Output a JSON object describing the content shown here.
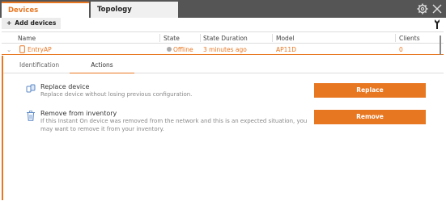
{
  "tabs": [
    {
      "label": "Devices",
      "active": true
    },
    {
      "label": "Topology",
      "active": false
    }
  ],
  "toolbar": {
    "add_label": "Add devices"
  },
  "table": {
    "headers": {
      "name": "Name",
      "state": "State",
      "state_duration": "State Duration",
      "model": "Model",
      "clients": "Clients"
    },
    "row": {
      "name": "EntryAP",
      "state": "Offline",
      "state_duration": "3 minutes ago",
      "model": "AP11D",
      "clients": "0"
    }
  },
  "detail_tabs": [
    {
      "label": "Identification",
      "active": false
    },
    {
      "label": "Actions",
      "active": true
    }
  ],
  "actions": {
    "replace": {
      "title": "Replace device",
      "desc": "Replace device without losing previous configuration.",
      "button": "Replace"
    },
    "remove": {
      "title": "Remove from inventory",
      "desc1": "If this Instant On device was removed from the network and this is an expected situation, you",
      "desc2": "may want to remove it from your inventory.",
      "button": "Remove"
    }
  },
  "colors": {
    "accent": "#e87722",
    "tabbar": "#555555",
    "offline": "#aaaaaa"
  },
  "icons": [
    "gear-icon",
    "close-icon",
    "plus-icon",
    "tool-icon",
    "device-icon",
    "replace-icon",
    "trash-icon",
    "chevron-down-icon"
  ]
}
